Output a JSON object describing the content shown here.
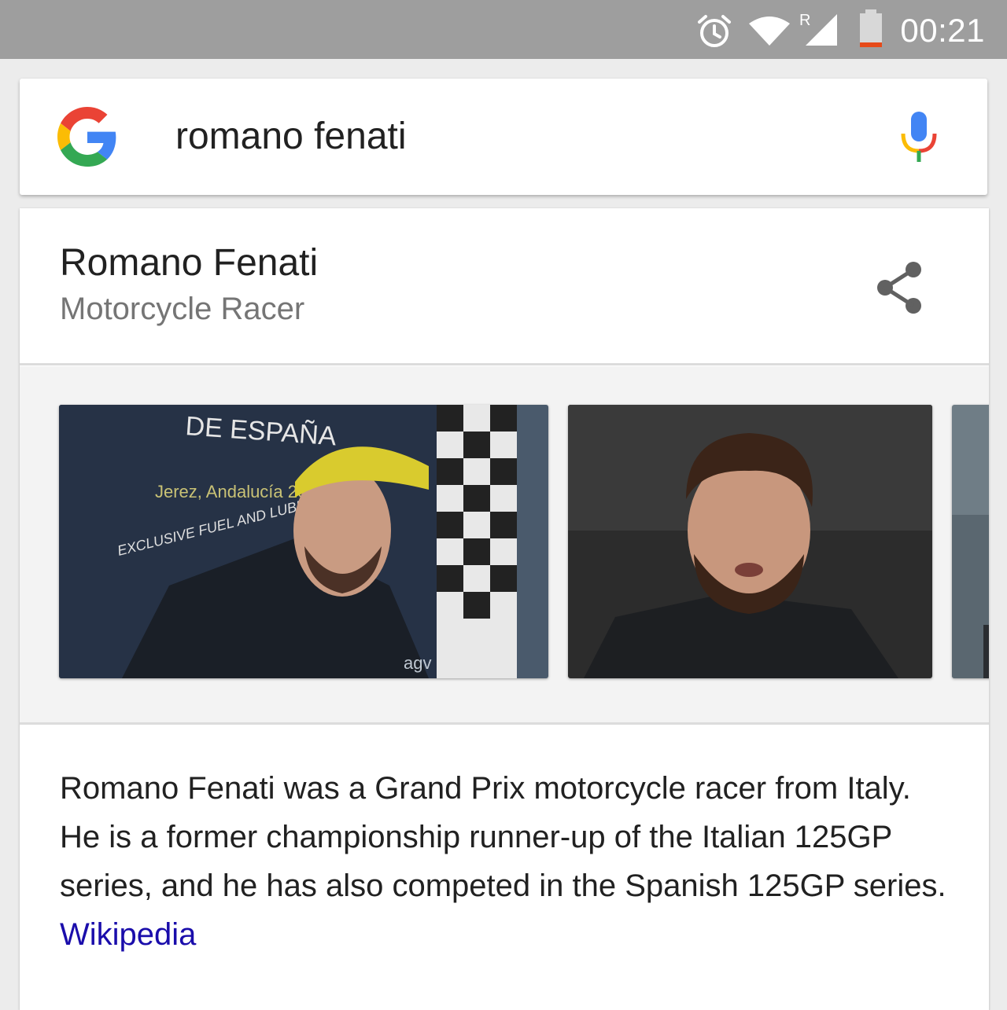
{
  "status_bar": {
    "time": "00:21",
    "icons": [
      "alarm-icon",
      "wifi-icon",
      "cell-signal-roaming-icon",
      "battery-low-icon"
    ],
    "roaming_indicator": "R",
    "colors": {
      "background": "#9e9e9e",
      "battery_low": "#e64a19"
    }
  },
  "search": {
    "query": "romano fenati",
    "logo": "google-g-icon",
    "voice_icon": "mic-icon"
  },
  "knowledge_panel": {
    "title": "Romano Fenati",
    "subtitle": "Motorcycle Racer",
    "share_icon": "share-icon",
    "images": [
      {
        "name": "photo-1",
        "signage": [
          "DE ESPAÑA",
          "Jerez, Andalucía 2014",
          "EXCLUSIVE FUEL AND LUBRICANT",
          "agv"
        ]
      },
      {
        "name": "photo-2"
      },
      {
        "name": "photo-3-partial"
      }
    ],
    "description": "Romano Fenati was a Grand Prix motorcycle racer from Italy. He is a former championship runner-up of the Italian 125GP series, and he has also competed in the Spanish 125GP series.",
    "source_link": "Wikipedia",
    "colors": {
      "link": "#1a0dab",
      "subtitle": "#757575"
    }
  }
}
